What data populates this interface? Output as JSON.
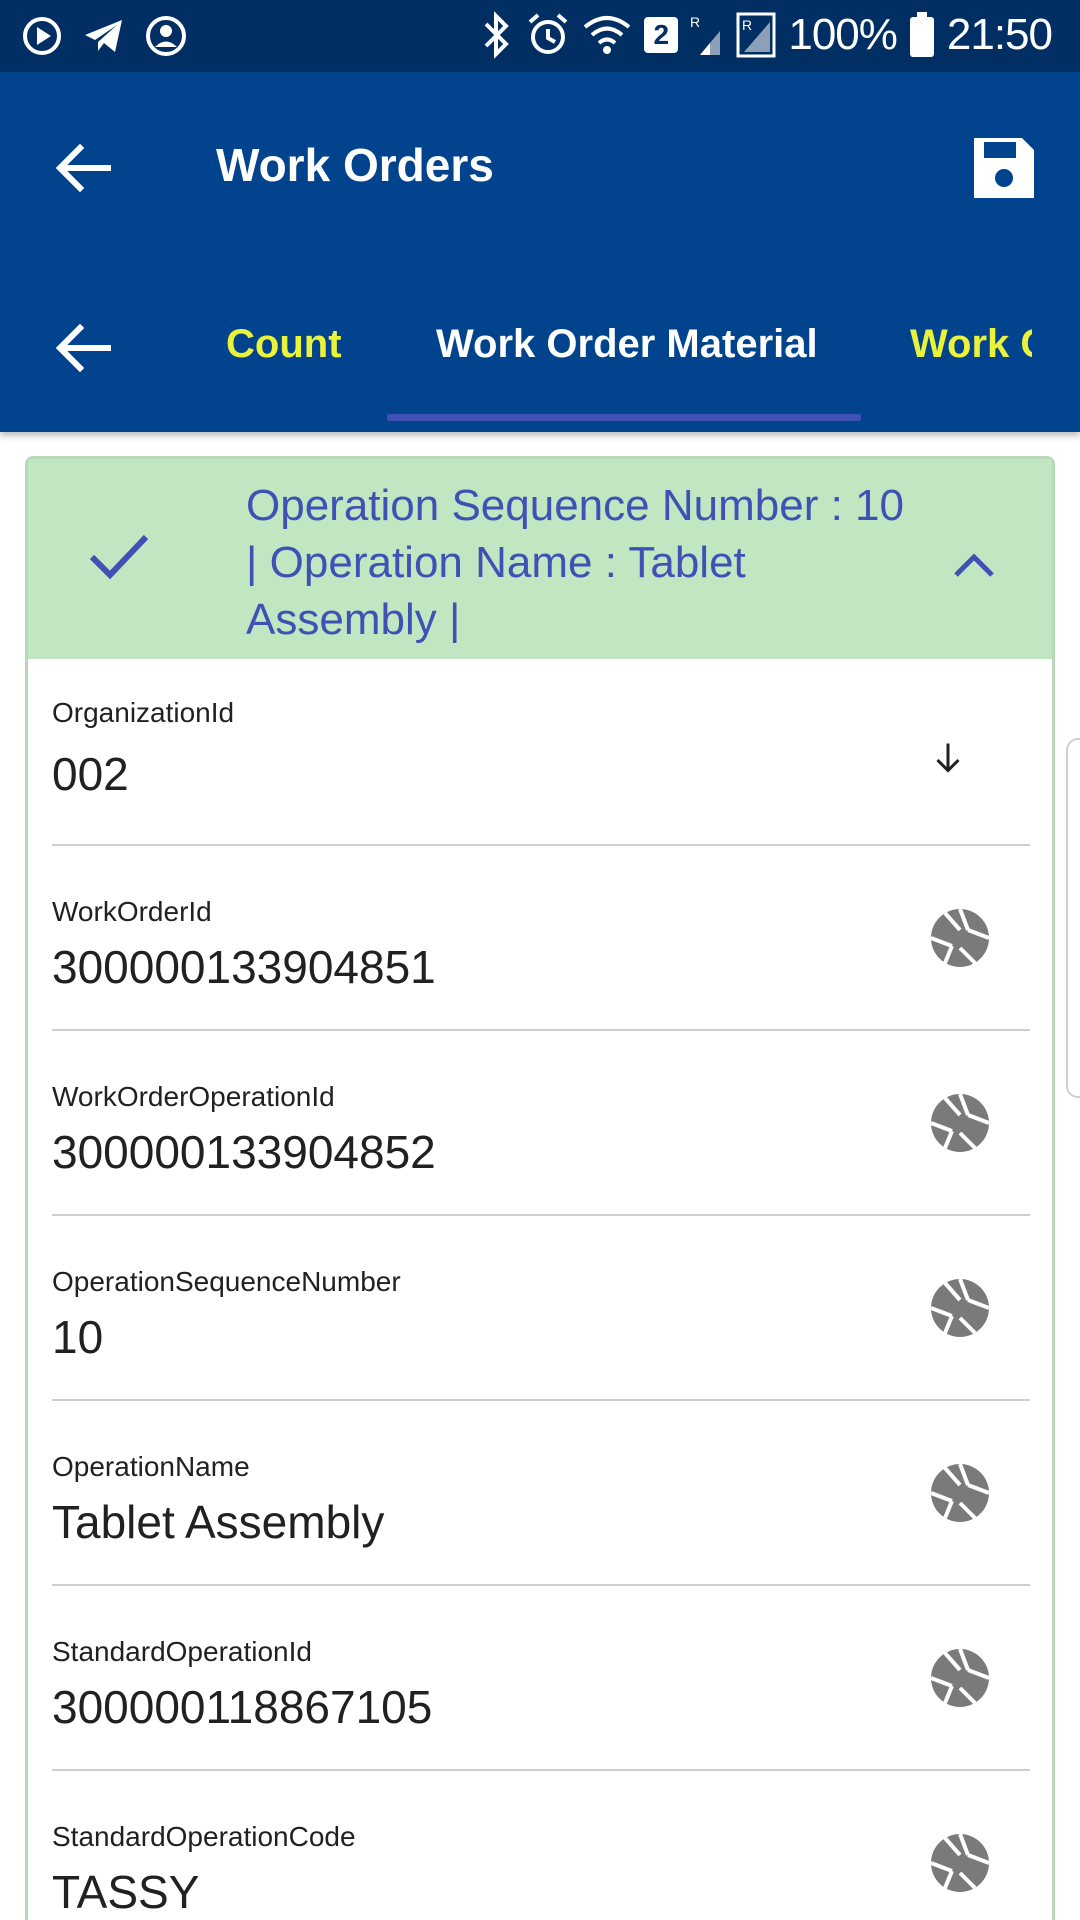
{
  "status_bar": {
    "battery": "100%",
    "time": "21:50",
    "sim_badge": "2",
    "icons": [
      "media-icon",
      "telegram-icon",
      "account-icon",
      "bluetooth-icon",
      "alarm-icon",
      "wifi-icon",
      "signal-icon",
      "battery-icon"
    ]
  },
  "app_bar": {
    "title": "Work Orders",
    "back_icon": "arrow-back-icon",
    "save_icon": "save-icon"
  },
  "tabs": {
    "items": [
      {
        "label": "Count",
        "active": false
      },
      {
        "label": "Work Order Material",
        "active": true
      },
      {
        "label": "Work C",
        "active": false
      }
    ]
  },
  "card": {
    "header_text": "Operation Sequence Number : 10 | Operation Name : Tablet Assembly |",
    "fields": [
      {
        "label": "OrganizationId",
        "value": "002",
        "icon": "arrow-down-icon"
      },
      {
        "label": "WorkOrderId",
        "value": "300000133904851",
        "icon": "camera-aperture-icon"
      },
      {
        "label": "WorkOrderOperationId",
        "value": "300000133904852",
        "icon": "camera-aperture-icon"
      },
      {
        "label": "OperationSequenceNumber",
        "value": "10",
        "icon": "camera-aperture-icon"
      },
      {
        "label": "OperationName",
        "value": "Tablet Assembly",
        "icon": "camera-aperture-icon"
      },
      {
        "label": "StandardOperationId",
        "value": "300000118867105",
        "icon": "camera-aperture-icon"
      },
      {
        "label": "StandardOperationCode",
        "value": "TASSY",
        "icon": "camera-aperture-icon"
      }
    ]
  },
  "colors": {
    "status_bar_bg": "#012f63",
    "app_bar_bg": "#01448d",
    "tab_active": "#ffffff",
    "tab_inactive": "#eaf23a",
    "tab_indicator": "#3f51b5",
    "card_header_bg": "#c2e6c1",
    "card_header_text": "#3f51b5"
  }
}
